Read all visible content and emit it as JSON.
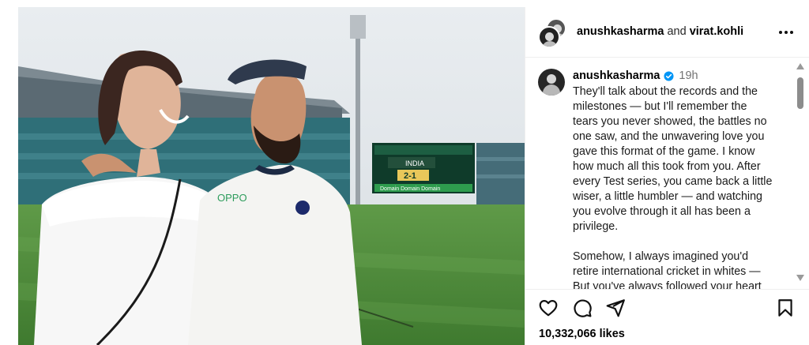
{
  "post": {
    "photo_description_icon": "post-photo",
    "photo_jersey_text": "OPPO",
    "photo_scoreboard": {
      "line1": "INDIA",
      "line2": "2-1",
      "sponsor": "Domain"
    }
  },
  "header": {
    "user1": "anushkasharma",
    "connector": "and",
    "user2": "virat.kohli",
    "more_icon": "more-horizontal-icon"
  },
  "caption": {
    "username": "anushkasharma",
    "verified_icon": "verified-badge-icon",
    "time": "19h",
    "paragraph1": "They'll talk about the records and the\nmilestones — but I'll remember the\ntears you never showed, the battles no\none saw, and the unwavering love you\ngave this format of the game. I know\nhow much all this took from you. After\nevery Test series, you came back a little\nwiser, a little humbler — and watching\nyou evolve through it all has been a\nprivilege.",
    "paragraph2": "Somehow, I always imagined you'd\nretire international cricket in whites —\nBut you've always followed your heart"
  },
  "actions": {
    "like_icon": "heart-icon",
    "comment_icon": "comment-icon",
    "share_icon": "send-icon",
    "save_icon": "bookmark-icon",
    "likes_text": "10,332,066 likes"
  },
  "colors": {
    "verified": "#0095f6",
    "muted_text": "#737373",
    "border": "#efefef"
  }
}
